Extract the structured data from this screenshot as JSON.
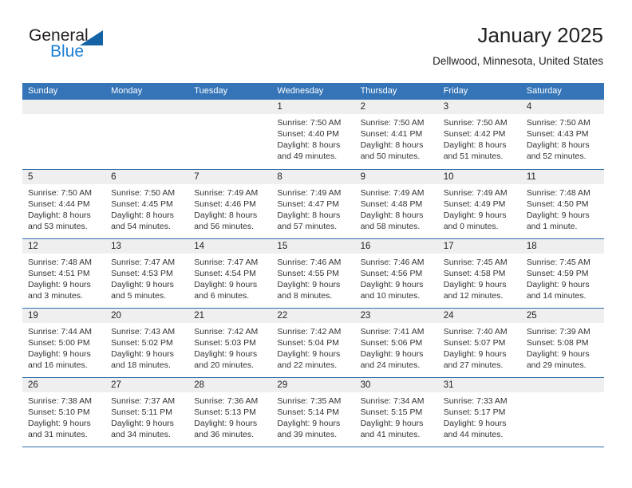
{
  "brand": {
    "name_part1": "General",
    "name_part2": "Blue",
    "accent_color": "#1b7fd4",
    "triangle_color": "#1464a5"
  },
  "header": {
    "month_title": "January 2025",
    "location": "Dellwood, Minnesota, United States"
  },
  "theme": {
    "header_row_bg": "#3575b7",
    "row_divider": "#2d6ca8",
    "day_band_bg": "#efefef"
  },
  "weekdays": [
    "Sunday",
    "Monday",
    "Tuesday",
    "Wednesday",
    "Thursday",
    "Friday",
    "Saturday"
  ],
  "weeks": [
    [
      {
        "day": "",
        "empty": true,
        "sunrise": "",
        "sunset": "",
        "daylight_line1": "",
        "daylight_line2": ""
      },
      {
        "day": "",
        "empty": true,
        "sunrise": "",
        "sunset": "",
        "daylight_line1": "",
        "daylight_line2": ""
      },
      {
        "day": "",
        "empty": true,
        "sunrise": "",
        "sunset": "",
        "daylight_line1": "",
        "daylight_line2": ""
      },
      {
        "day": "1",
        "empty": false,
        "sunrise": "Sunrise: 7:50 AM",
        "sunset": "Sunset: 4:40 PM",
        "daylight_line1": "Daylight: 8 hours",
        "daylight_line2": "and 49 minutes."
      },
      {
        "day": "2",
        "empty": false,
        "sunrise": "Sunrise: 7:50 AM",
        "sunset": "Sunset: 4:41 PM",
        "daylight_line1": "Daylight: 8 hours",
        "daylight_line2": "and 50 minutes."
      },
      {
        "day": "3",
        "empty": false,
        "sunrise": "Sunrise: 7:50 AM",
        "sunset": "Sunset: 4:42 PM",
        "daylight_line1": "Daylight: 8 hours",
        "daylight_line2": "and 51 minutes."
      },
      {
        "day": "4",
        "empty": false,
        "sunrise": "Sunrise: 7:50 AM",
        "sunset": "Sunset: 4:43 PM",
        "daylight_line1": "Daylight: 8 hours",
        "daylight_line2": "and 52 minutes."
      }
    ],
    [
      {
        "day": "5",
        "empty": false,
        "sunrise": "Sunrise: 7:50 AM",
        "sunset": "Sunset: 4:44 PM",
        "daylight_line1": "Daylight: 8 hours",
        "daylight_line2": "and 53 minutes."
      },
      {
        "day": "6",
        "empty": false,
        "sunrise": "Sunrise: 7:50 AM",
        "sunset": "Sunset: 4:45 PM",
        "daylight_line1": "Daylight: 8 hours",
        "daylight_line2": "and 54 minutes."
      },
      {
        "day": "7",
        "empty": false,
        "sunrise": "Sunrise: 7:49 AM",
        "sunset": "Sunset: 4:46 PM",
        "daylight_line1": "Daylight: 8 hours",
        "daylight_line2": "and 56 minutes."
      },
      {
        "day": "8",
        "empty": false,
        "sunrise": "Sunrise: 7:49 AM",
        "sunset": "Sunset: 4:47 PM",
        "daylight_line1": "Daylight: 8 hours",
        "daylight_line2": "and 57 minutes."
      },
      {
        "day": "9",
        "empty": false,
        "sunrise": "Sunrise: 7:49 AM",
        "sunset": "Sunset: 4:48 PM",
        "daylight_line1": "Daylight: 8 hours",
        "daylight_line2": "and 58 minutes."
      },
      {
        "day": "10",
        "empty": false,
        "sunrise": "Sunrise: 7:49 AM",
        "sunset": "Sunset: 4:49 PM",
        "daylight_line1": "Daylight: 9 hours",
        "daylight_line2": "and 0 minutes."
      },
      {
        "day": "11",
        "empty": false,
        "sunrise": "Sunrise: 7:48 AM",
        "sunset": "Sunset: 4:50 PM",
        "daylight_line1": "Daylight: 9 hours",
        "daylight_line2": "and 1 minute."
      }
    ],
    [
      {
        "day": "12",
        "empty": false,
        "sunrise": "Sunrise: 7:48 AM",
        "sunset": "Sunset: 4:51 PM",
        "daylight_line1": "Daylight: 9 hours",
        "daylight_line2": "and 3 minutes."
      },
      {
        "day": "13",
        "empty": false,
        "sunrise": "Sunrise: 7:47 AM",
        "sunset": "Sunset: 4:53 PM",
        "daylight_line1": "Daylight: 9 hours",
        "daylight_line2": "and 5 minutes."
      },
      {
        "day": "14",
        "empty": false,
        "sunrise": "Sunrise: 7:47 AM",
        "sunset": "Sunset: 4:54 PM",
        "daylight_line1": "Daylight: 9 hours",
        "daylight_line2": "and 6 minutes."
      },
      {
        "day": "15",
        "empty": false,
        "sunrise": "Sunrise: 7:46 AM",
        "sunset": "Sunset: 4:55 PM",
        "daylight_line1": "Daylight: 9 hours",
        "daylight_line2": "and 8 minutes."
      },
      {
        "day": "16",
        "empty": false,
        "sunrise": "Sunrise: 7:46 AM",
        "sunset": "Sunset: 4:56 PM",
        "daylight_line1": "Daylight: 9 hours",
        "daylight_line2": "and 10 minutes."
      },
      {
        "day": "17",
        "empty": false,
        "sunrise": "Sunrise: 7:45 AM",
        "sunset": "Sunset: 4:58 PM",
        "daylight_line1": "Daylight: 9 hours",
        "daylight_line2": "and 12 minutes."
      },
      {
        "day": "18",
        "empty": false,
        "sunrise": "Sunrise: 7:45 AM",
        "sunset": "Sunset: 4:59 PM",
        "daylight_line1": "Daylight: 9 hours",
        "daylight_line2": "and 14 minutes."
      }
    ],
    [
      {
        "day": "19",
        "empty": false,
        "sunrise": "Sunrise: 7:44 AM",
        "sunset": "Sunset: 5:00 PM",
        "daylight_line1": "Daylight: 9 hours",
        "daylight_line2": "and 16 minutes."
      },
      {
        "day": "20",
        "empty": false,
        "sunrise": "Sunrise: 7:43 AM",
        "sunset": "Sunset: 5:02 PM",
        "daylight_line1": "Daylight: 9 hours",
        "daylight_line2": "and 18 minutes."
      },
      {
        "day": "21",
        "empty": false,
        "sunrise": "Sunrise: 7:42 AM",
        "sunset": "Sunset: 5:03 PM",
        "daylight_line1": "Daylight: 9 hours",
        "daylight_line2": "and 20 minutes."
      },
      {
        "day": "22",
        "empty": false,
        "sunrise": "Sunrise: 7:42 AM",
        "sunset": "Sunset: 5:04 PM",
        "daylight_line1": "Daylight: 9 hours",
        "daylight_line2": "and 22 minutes."
      },
      {
        "day": "23",
        "empty": false,
        "sunrise": "Sunrise: 7:41 AM",
        "sunset": "Sunset: 5:06 PM",
        "daylight_line1": "Daylight: 9 hours",
        "daylight_line2": "and 24 minutes."
      },
      {
        "day": "24",
        "empty": false,
        "sunrise": "Sunrise: 7:40 AM",
        "sunset": "Sunset: 5:07 PM",
        "daylight_line1": "Daylight: 9 hours",
        "daylight_line2": "and 27 minutes."
      },
      {
        "day": "25",
        "empty": false,
        "sunrise": "Sunrise: 7:39 AM",
        "sunset": "Sunset: 5:08 PM",
        "daylight_line1": "Daylight: 9 hours",
        "daylight_line2": "and 29 minutes."
      }
    ],
    [
      {
        "day": "26",
        "empty": false,
        "sunrise": "Sunrise: 7:38 AM",
        "sunset": "Sunset: 5:10 PM",
        "daylight_line1": "Daylight: 9 hours",
        "daylight_line2": "and 31 minutes."
      },
      {
        "day": "27",
        "empty": false,
        "sunrise": "Sunrise: 7:37 AM",
        "sunset": "Sunset: 5:11 PM",
        "daylight_line1": "Daylight: 9 hours",
        "daylight_line2": "and 34 minutes."
      },
      {
        "day": "28",
        "empty": false,
        "sunrise": "Sunrise: 7:36 AM",
        "sunset": "Sunset: 5:13 PM",
        "daylight_line1": "Daylight: 9 hours",
        "daylight_line2": "and 36 minutes."
      },
      {
        "day": "29",
        "empty": false,
        "sunrise": "Sunrise: 7:35 AM",
        "sunset": "Sunset: 5:14 PM",
        "daylight_line1": "Daylight: 9 hours",
        "daylight_line2": "and 39 minutes."
      },
      {
        "day": "30",
        "empty": false,
        "sunrise": "Sunrise: 7:34 AM",
        "sunset": "Sunset: 5:15 PM",
        "daylight_line1": "Daylight: 9 hours",
        "daylight_line2": "and 41 minutes."
      },
      {
        "day": "31",
        "empty": false,
        "sunrise": "Sunrise: 7:33 AM",
        "sunset": "Sunset: 5:17 PM",
        "daylight_line1": "Daylight: 9 hours",
        "daylight_line2": "and 44 minutes."
      },
      {
        "day": "",
        "empty": true,
        "sunrise": "",
        "sunset": "",
        "daylight_line1": "",
        "daylight_line2": ""
      }
    ]
  ]
}
